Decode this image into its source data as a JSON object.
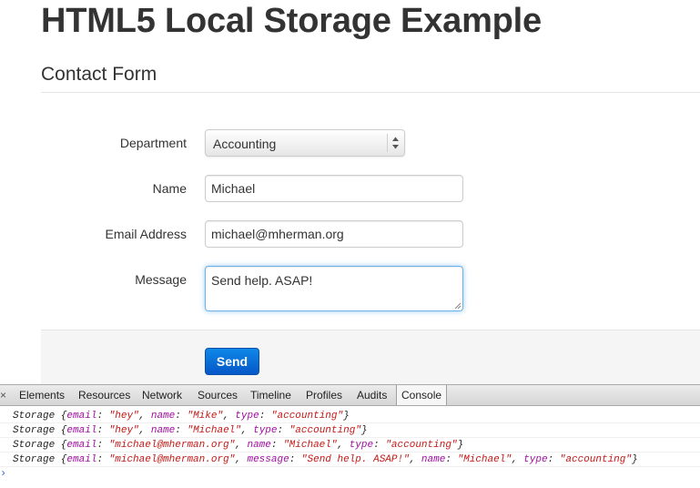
{
  "page": {
    "title": "HTML5 Local Storage Example",
    "legend": "Contact Form"
  },
  "form": {
    "department_label": "Department",
    "department_value": "Accounting",
    "name_label": "Name",
    "name_value": "Michael",
    "email_label": "Email Address",
    "email_value": "michael@mherman.org",
    "message_label": "Message",
    "message_value": "Send help. ASAP!",
    "send_label": "Send"
  },
  "devtools": {
    "close_glyph": "×",
    "tabs": [
      "Elements",
      "Resources",
      "Network",
      "Sources",
      "Timeline",
      "Profiles",
      "Audits",
      "Console"
    ],
    "active_tab": "Console",
    "prompt_glyph": "›",
    "console_lines": [
      [
        [
          "Storage {",
          "p"
        ],
        [
          "email",
          "k"
        ],
        [
          ": ",
          "p"
        ],
        [
          "\"hey\"",
          "s"
        ],
        [
          ", ",
          "p"
        ],
        [
          "name",
          "k"
        ],
        [
          ": ",
          "p"
        ],
        [
          "\"Mike\"",
          "s"
        ],
        [
          ", ",
          "p"
        ],
        [
          "type",
          "k"
        ],
        [
          ": ",
          "p"
        ],
        [
          "\"accounting\"",
          "s"
        ],
        [
          "}",
          "p"
        ]
      ],
      [
        [
          "Storage {",
          "p"
        ],
        [
          "email",
          "k"
        ],
        [
          ": ",
          "p"
        ],
        [
          "\"hey\"",
          "s"
        ],
        [
          ", ",
          "p"
        ],
        [
          "name",
          "k"
        ],
        [
          ": ",
          "p"
        ],
        [
          "\"Michael\"",
          "s"
        ],
        [
          ", ",
          "p"
        ],
        [
          "type",
          "k"
        ],
        [
          ": ",
          "p"
        ],
        [
          "\"accounting\"",
          "s"
        ],
        [
          "}",
          "p"
        ]
      ],
      [
        [
          "Storage {",
          "p"
        ],
        [
          "email",
          "k"
        ],
        [
          ": ",
          "p"
        ],
        [
          "\"michael@mherman.org\"",
          "s"
        ],
        [
          ", ",
          "p"
        ],
        [
          "name",
          "k"
        ],
        [
          ": ",
          "p"
        ],
        [
          "\"Michael\"",
          "s"
        ],
        [
          ", ",
          "p"
        ],
        [
          "type",
          "k"
        ],
        [
          ": ",
          "p"
        ],
        [
          "\"accounting\"",
          "s"
        ],
        [
          "}",
          "p"
        ]
      ],
      [
        [
          "Storage {",
          "p"
        ],
        [
          "email",
          "k"
        ],
        [
          ": ",
          "p"
        ],
        [
          "\"michael@mherman.org\"",
          "s"
        ],
        [
          ", ",
          "p"
        ],
        [
          "message",
          "k"
        ],
        [
          ": ",
          "p"
        ],
        [
          "\"Send help. ASAP!\"",
          "s"
        ],
        [
          ", ",
          "p"
        ],
        [
          "name",
          "k"
        ],
        [
          ": ",
          "p"
        ],
        [
          "\"Michael\"",
          "s"
        ],
        [
          ", ",
          "p"
        ],
        [
          "type",
          "k"
        ],
        [
          ": ",
          "p"
        ],
        [
          "\"accounting\"",
          "s"
        ],
        [
          "}",
          "p"
        ]
      ]
    ]
  },
  "colors": {
    "accent": "#0f88e8",
    "focus_border": "#6fb3e6",
    "console_key": "#a10fa1",
    "console_string": "#c41a16"
  }
}
